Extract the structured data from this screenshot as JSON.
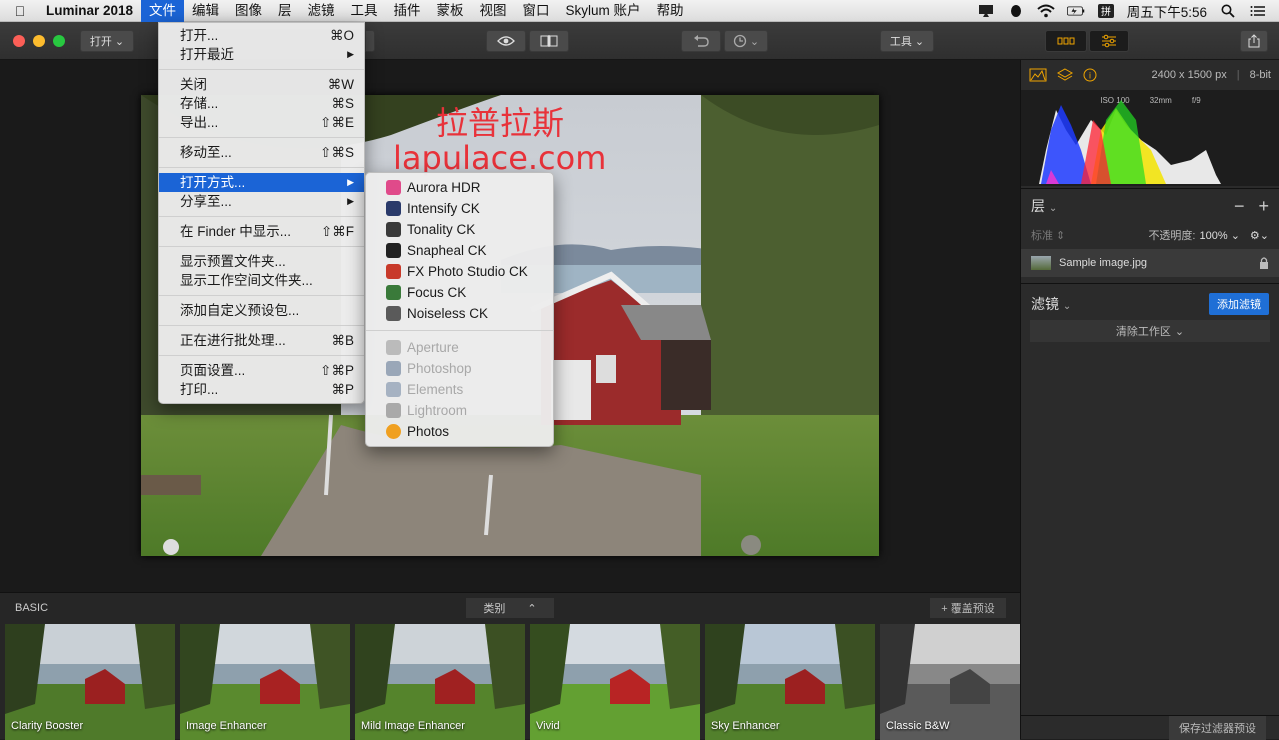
{
  "menubar": {
    "app": "Luminar 2018",
    "items": [
      "文件",
      "编辑",
      "图像",
      "层",
      "滤镜",
      "工具",
      "插件",
      "蒙板",
      "视图",
      "窗口",
      "Skylum 账户",
      "帮助"
    ],
    "clock": "周五下午5:56"
  },
  "toolbar": {
    "open_label": "打开",
    "tools_label": "工具"
  },
  "image_info": {
    "size": "2400 x 1500 px",
    "depth": "8-bit",
    "iso": "ISO 100",
    "focal": "32mm",
    "aperture": "f/9"
  },
  "watermark": {
    "cn": "拉普拉斯",
    "en": "lapulace.com"
  },
  "file_menu": {
    "groups": [
      [
        {
          "label": "打开...",
          "shortcut": "⌘O"
        },
        {
          "label": "打开最近",
          "shortcut": "▶"
        }
      ],
      [
        {
          "label": "关闭",
          "shortcut": "⌘W"
        },
        {
          "label": "存储...",
          "shortcut": "⌘S"
        },
        {
          "label": "导出...",
          "shortcut": "⇧⌘E"
        }
      ],
      [
        {
          "label": "移动至...",
          "shortcut": "⇧⌘S"
        }
      ],
      [
        {
          "label": "打开方式...",
          "shortcut": "▶"
        },
        {
          "label": "分享至...",
          "shortcut": "▶"
        }
      ],
      [
        {
          "label": "在 Finder 中显示...",
          "shortcut": "⇧⌘F"
        }
      ],
      [
        {
          "label": "显示预置文件夹...",
          "shortcut": ""
        },
        {
          "label": "显示工作空间文件夹...",
          "shortcut": ""
        }
      ],
      [
        {
          "label": "添加自定义预设包...",
          "shortcut": ""
        }
      ],
      [
        {
          "label": "正在进行批处理...",
          "shortcut": "⌘B"
        }
      ],
      [
        {
          "label": "页面设置...",
          "shortcut": "⇧⌘P"
        },
        {
          "label": "打印...",
          "shortcut": "⌘P"
        }
      ]
    ]
  },
  "open_with": {
    "enabled": [
      {
        "label": "Aurora HDR",
        "color": "#e04a8a"
      },
      {
        "label": "Intensify CK",
        "color": "#2a3a6a"
      },
      {
        "label": "Tonality CK",
        "color": "#3a3a3a"
      },
      {
        "label": "Snapheal CK",
        "color": "#222222"
      },
      {
        "label": "FX Photo Studio CK",
        "color": "#c83a2a"
      },
      {
        "label": "Focus CK",
        "color": "#3a7a3a"
      },
      {
        "label": "Noiseless CK",
        "color": "#5a5a5a"
      }
    ],
    "disabled": [
      {
        "label": "Aperture",
        "color": "#bbbbbb"
      },
      {
        "label": "Photoshop",
        "color": "#9aa7b8"
      },
      {
        "label": "Elements",
        "color": "#a6b2c2"
      },
      {
        "label": "Lightroom",
        "color": "#a9a9a9"
      }
    ],
    "photos": {
      "label": "Photos",
      "color": "#f0a020"
    }
  },
  "layers": {
    "title": "层",
    "blend": "标准",
    "opacity_label": "不透明度:",
    "opacity_value": "100%",
    "layer_name": "Sample image.jpg"
  },
  "filters": {
    "title": "滤镜",
    "add_label": "添加滤镜",
    "clear_label": "清除工作区"
  },
  "bottom": {
    "category_title": "BASIC",
    "category_dropdown": "类别",
    "overwrite_label": "+ 覆盖预设",
    "save_preset": "保存过滤器预设",
    "presets": [
      "Clarity Booster",
      "Image Enhancer",
      "Mild Image Enhancer",
      "Vivid",
      "Sky Enhancer",
      "Classic B&W"
    ]
  },
  "colors": {
    "accent": "#1b64d6",
    "add_filter_bg": "#1f6fd6",
    "watermark": "#e8323a"
  }
}
